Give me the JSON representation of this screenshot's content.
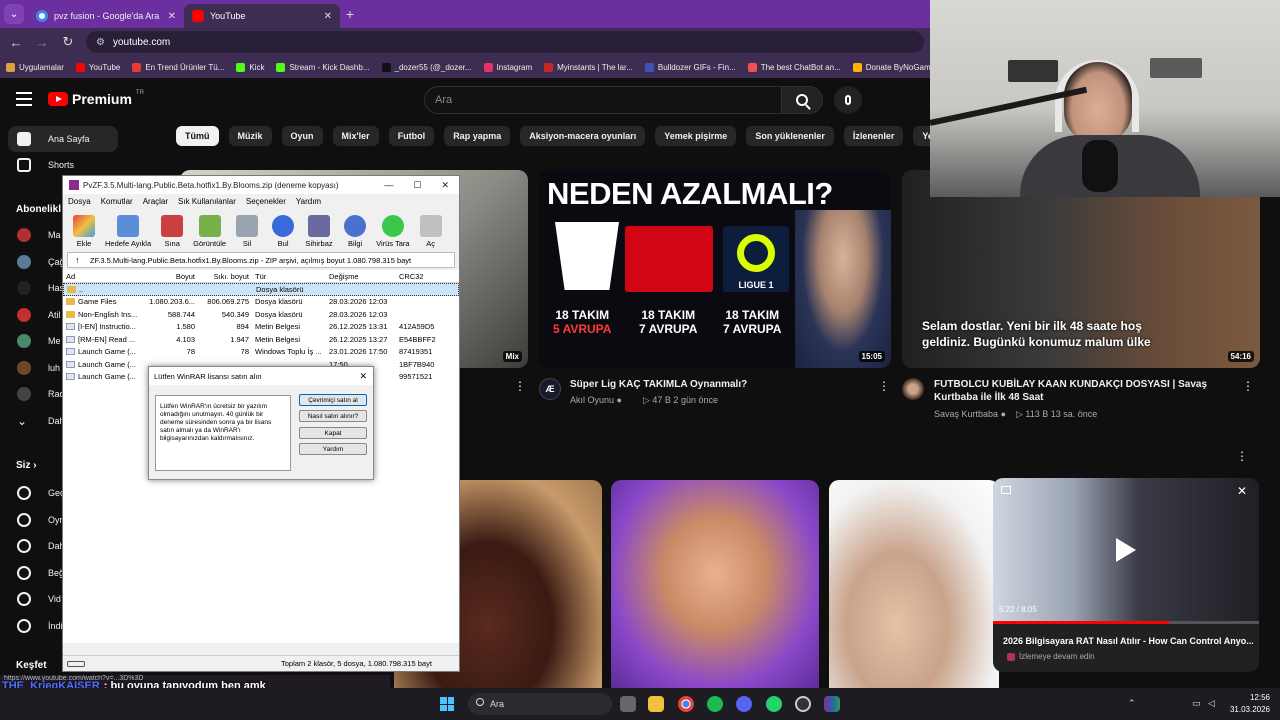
{
  "browser": {
    "tabs": [
      {
        "label": "pvz fusion - Google'da Ara",
        "close": "✕"
      },
      {
        "label": "YouTube",
        "close": "✕"
      }
    ],
    "new_tab": "+",
    "url": "youtube.com",
    "nav": {
      "back": "←",
      "forward": "→",
      "reload": "↻",
      "menu": "⌄"
    },
    "bookmarks": [
      {
        "label": "Uygulamalar",
        "color": "#e0a040"
      },
      {
        "label": "YouTube",
        "color": "#ff0000"
      },
      {
        "label": "En Trend Ürünler Tü...",
        "color": "#e53935"
      },
      {
        "label": "Kick",
        "color": "#53fc18"
      },
      {
        "label": "Stream - Kick Dashb...",
        "color": "#53fc18"
      },
      {
        "label": "_dozer55 (@_dozer...",
        "color": "#111111"
      },
      {
        "label": "Instagram",
        "color": "#e1306c"
      },
      {
        "label": "Myinstants | The lar...",
        "color": "#c62828"
      },
      {
        "label": "Bulldozer GIFs - Fin...",
        "color": "#3f51b5"
      },
      {
        "label": "The best ChatBot an...",
        "color": "#ef5350"
      },
      {
        "label": "Donate ByNoGam",
        "color": "#ffb300"
      }
    ]
  },
  "youtube": {
    "logo": "Premium",
    "logo_sup": "TR",
    "search_placeholder": "Ara",
    "sidebar": {
      "top": [
        {
          "label": "Ana Sayfa"
        },
        {
          "label": "Shorts"
        }
      ],
      "subscriptions_title": "Abonelikl",
      "subscriptions": [
        "Ma",
        "Çağ",
        "Has",
        "Atil",
        "Me",
        "luh",
        "Rac",
        "Dah"
      ],
      "you_title": "Siz",
      "you_chevron": "›",
      "you": [
        "Geç",
        "Oyn",
        "Dah",
        "Beğ",
        "Vid",
        "İndi"
      ],
      "explore_title": "Keşfet"
    },
    "chips": [
      "Tümü",
      "Müzik",
      "Oyun",
      "Mix'ler",
      "Futbol",
      "Rap yapma",
      "Aksiyon-macera oyunları",
      "Yemek pişirme",
      "Son yüklenenler",
      "İzlenenler",
      "Yeni öneriler"
    ],
    "videos": [
      {
        "badge": "Mix"
      },
      {
        "thumb_text": "NEDEN AZALMALI?",
        "thumb_cols": [
          "18 TAKIM",
          "5 AVRUPA",
          "18 TAKIM",
          "7 AVRUPA",
          "18 TAKIM",
          "7 AVRUPA"
        ],
        "thumb_league": "LIGUE 1",
        "duration": "15:05",
        "title": "Süper Lig KAÇ TAKIMLA Oynanmalı?",
        "channel": "Akıl Oyunu",
        "meta": "▷ 47 B  2 gün önce"
      },
      {
        "thumb_text": "Selam dostlar. Yeni bir ilk 48 saate hoş geldiniz. Bugünkü konumuz malum ülke",
        "duration": "54:16",
        "title": "FUTBOLCU KUBİLAY KAAN KUNDAKÇI DOSYASI | Savaş Kurtbaba ile İlk 48 Saat",
        "channel": "Savaş Kurtbaba",
        "meta": "▷ 113 B  13 sa. önce"
      }
    ],
    "more": "⋮",
    "miniplayer": {
      "time": "5:22 / 8:05",
      "title": "2026 Bilgisayara RAT Nasıl Atılır - How Can Control Anyo...",
      "subtitle": "İzlemeye devam edin",
      "close": "✕"
    }
  },
  "winrar": {
    "title": "PvZF.3.5.Multi-lang.Public.Beta.hotfix1.By.Blooms.zip (deneme kopyası)",
    "window_controls": [
      "—",
      "☐",
      "✕"
    ],
    "menu": [
      "Dosya",
      "Komutlar",
      "Araçlar",
      "Sık Kullanılanlar",
      "Seçenekler",
      "Yardım"
    ],
    "tools": [
      "Ekle",
      "Hedefe Ayıkla",
      "Sına",
      "Görüntüle",
      "Sil",
      "Bul",
      "Sihirbaz",
      "Bilgi",
      "Virüs Tara",
      "Aç"
    ],
    "path": "ZF.3.5.Multi-lang.Public.Beta.hotfix1.By.Blooms.zip - ZIP arşivi, açılmış boyut 1.080.798.315 bayt",
    "columns": [
      "Ad",
      "Boyut",
      "Sıkı. boyut",
      "Tür",
      "Değişme",
      "CRC32"
    ],
    "rows": [
      {
        "name": "..",
        "size": "",
        "packed": "",
        "type": "Dosya klasörü",
        "modified": "",
        "crc": "",
        "icon": "folder"
      },
      {
        "name": "Game Files",
        "size": "1.080.203.6...",
        "packed": "806.069.275",
        "type": "Dosya klasörü",
        "modified": "28.03.2026 12:03",
        "crc": "",
        "icon": "folder"
      },
      {
        "name": "Non-English Ins...",
        "size": "588.744",
        "packed": "540.349",
        "type": "Dosya klasörü",
        "modified": "28.03.2026 12:03",
        "crc": "",
        "icon": "folder"
      },
      {
        "name": "[I-EN] Instructio...",
        "size": "1.580",
        "packed": "894",
        "type": "Metin Belgesi",
        "modified": "26.12.2025 13:31",
        "crc": "412A59D5",
        "icon": "doc"
      },
      {
        "name": "[RM-EN] Read ...",
        "size": "4.103",
        "packed": "1.947",
        "type": "Metin Belgesi",
        "modified": "26.12.2025 13:27",
        "crc": "E54BBFF2",
        "icon": "doc"
      },
      {
        "name": "Launch Game (...",
        "size": "78",
        "packed": "78",
        "type": "Windows Toplu İş ...",
        "modified": "23.01.2026 17:50",
        "crc": "87419351",
        "icon": "doc"
      },
      {
        "name": "Launch Game (...",
        "size": "",
        "packed": "",
        "type": "",
        "modified": "17:50",
        "crc": "1BF7B940",
        "icon": "doc"
      },
      {
        "name": "Launch Game (...",
        "size": "",
        "packed": "",
        "type": "",
        "modified": "7:47",
        "crc": "99571521",
        "icon": "doc"
      }
    ],
    "status": "Toplam 2 klasör, 5 dosya, 1.080.798.315 bayt"
  },
  "license_dialog": {
    "title": "Lütfen WinRAR lisansı satın alın",
    "close": "✕",
    "message": "Lütfen WinRAR'ın ücretsiz bir yazılım olmadığını unutmayın. 40 günlük bir deneme süresinden sonra ya bir lisans satın almalı ya da WinRAR'ı bilgisayarınızdan kaldırmalısınız.",
    "buttons": [
      "Çevrimiçi satın al",
      "Nasıl satın alınır?",
      "Kapat",
      "Yardım"
    ]
  },
  "chat": {
    "url": "https://www.youtube.com/watch?v=...3D%3D",
    "user": "THE_KriegKAISER",
    "message": ": bu oyuna tapıyodum ben amk"
  },
  "taskbar": {
    "search": "Ara",
    "time": "12:56",
    "date": "31.03.2026"
  }
}
